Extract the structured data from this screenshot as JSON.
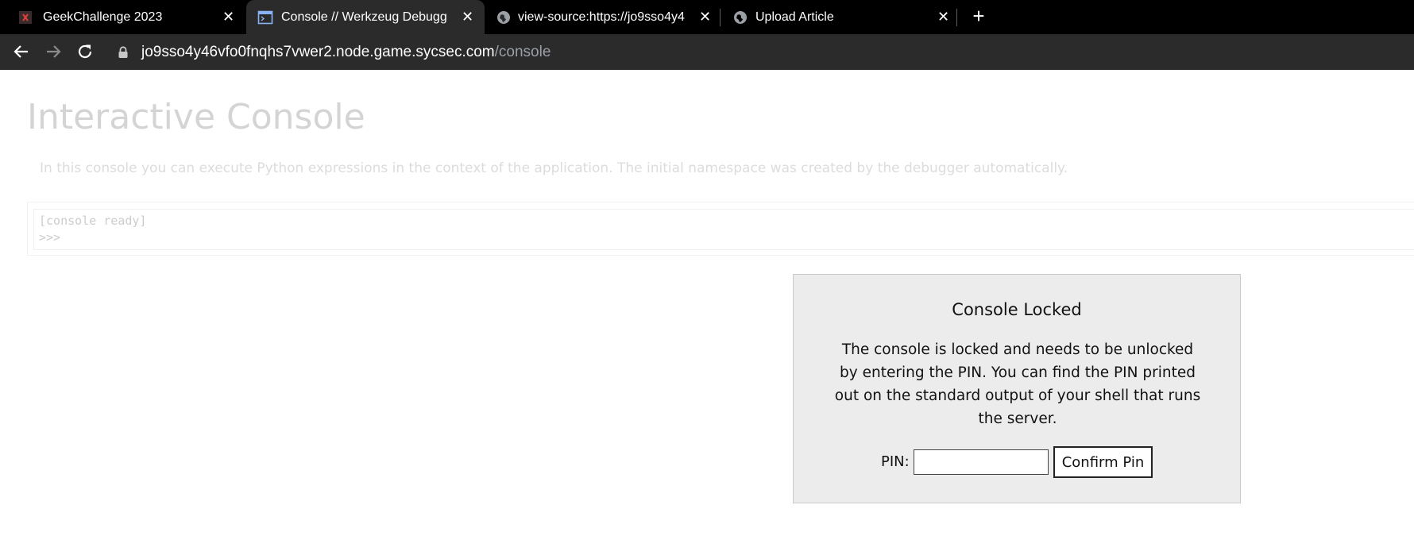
{
  "browser": {
    "tabs": [
      {
        "title": "GeekChallenge 2023",
        "icon": "geek-favicon-icon",
        "active": false
      },
      {
        "title": "Console // Werkzeug Debugg",
        "icon": "console-favicon-icon",
        "active": true
      },
      {
        "title": "view-source:https://jo9sso4y4",
        "icon": "globe-icon",
        "active": false
      },
      {
        "title": "Upload Article",
        "icon": "globe-icon",
        "active": false
      }
    ],
    "close_glyph": "✕",
    "new_tab_glyph": "+",
    "url_host": "jo9sso4y46vfo0fnqhs7vwer2.node.game.sycsec.com",
    "url_path": "/console"
  },
  "page": {
    "heading": "Interactive Console",
    "intro": "In this console you can execute Python expressions in the context of the application. The initial namespace was created by the debugger automatically.",
    "console_lines": [
      "[console ready]",
      ">>>"
    ]
  },
  "pin_dialog": {
    "title": "Console Locked",
    "text": "The console is locked and needs to be unlocked by entering the PIN. You can find the PIN printed out on the standard output of your shell that runs the server.",
    "pin_label": "PIN:",
    "pin_value": "",
    "submit_label": "Confirm Pin"
  },
  "colors": {
    "tabbar": "#000000",
    "toolbar": "#2b2b2b",
    "faded_text": "#d4d4d4",
    "dialog_bg": "#ececec"
  }
}
